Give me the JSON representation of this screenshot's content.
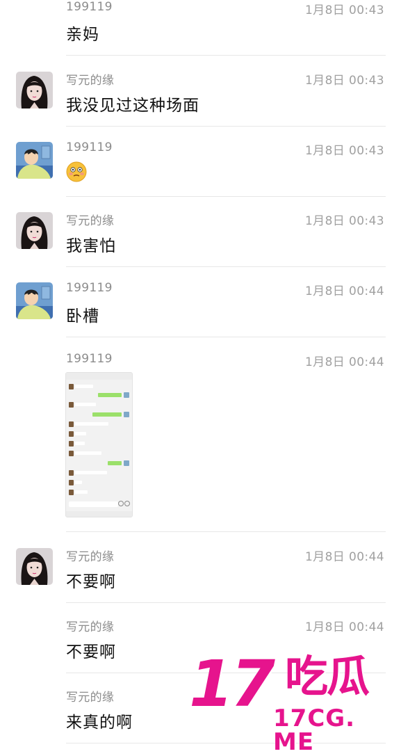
{
  "messages": [
    {
      "sender": "199119",
      "time": "1月8日 00:43",
      "text": "亲妈",
      "avatar": "cartoon"
    },
    {
      "sender": "写元的缘",
      "time": "1月8日 00:43",
      "text": "我没见过这种场面",
      "avatar": "girl"
    },
    {
      "sender": "199119",
      "time": "1月8日 00:43",
      "text": "",
      "emoji": "embarrassed-face-icon",
      "avatar": "cartoon"
    },
    {
      "sender": "写元的缘",
      "time": "1月8日 00:43",
      "text": "我害怕",
      "avatar": "girl"
    },
    {
      "sender": "199119",
      "time": "1月8日 00:44",
      "text": "卧槽",
      "avatar": "cartoon"
    },
    {
      "sender": "199119",
      "time": "1月8日 00:44",
      "text": "",
      "image": "chat-screenshot-thumbnail",
      "avatar": "none"
    },
    {
      "sender": "写元的缘",
      "time": "1月8日 00:44",
      "text": "不要啊",
      "avatar": "girl"
    },
    {
      "sender": "写元的缘",
      "time": "1月8日 00:44",
      "text": "不要啊",
      "avatar": "none"
    },
    {
      "sender": "写元的缘",
      "time": "",
      "text": "来真的啊",
      "avatar": "none"
    }
  ],
  "watermark": {
    "number": "17",
    "chinese": "吃瓜",
    "url": "17CG. ME",
    "color": "#e6148d"
  }
}
